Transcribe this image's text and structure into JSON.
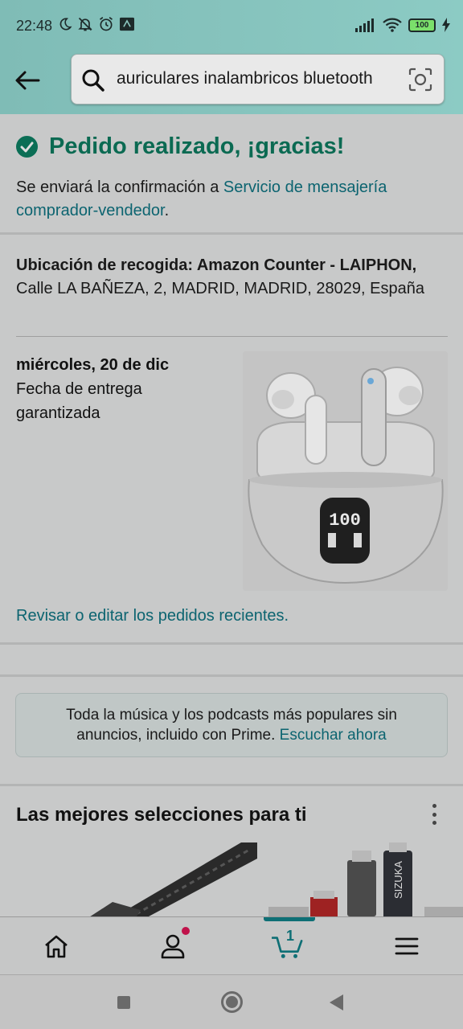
{
  "status_bar": {
    "time": "22:48",
    "battery": "100"
  },
  "header": {
    "search_query": "auriculares inalambricos bluetooth"
  },
  "confirmation": {
    "title": "Pedido realizado, ¡gracias!",
    "text_prefix": "Se enviará la confirmación a ",
    "link_text": "Servicio de mensajería comprador-vendedor",
    "text_suffix": "."
  },
  "pickup": {
    "label": "Ubicación de recogida: Amazon Counter - LAIPHON,",
    "address": "Calle LA BAÑEZA, 2, MADRID, MADRID, 28029, España",
    "delivery_date": "miércoles, 20 de dic",
    "delivery_note_line1": "Fecha de entrega",
    "delivery_note_line2": "garantizada",
    "product_display": "100",
    "review_link": "Revisar o editar los pedidos recientes."
  },
  "promo": {
    "text": "Toda la música y los podcasts más populares sin anuncios, incluido con Prime. ",
    "link": "Escuchar ahora"
  },
  "picks": {
    "title": "Las mejores selecciones para ti",
    "brand_text": "SIZUKA"
  },
  "bottom_nav": {
    "cart_count": "1",
    "items": [
      "home-icon",
      "account-icon",
      "cart-icon",
      "menu-icon"
    ]
  },
  "colors": {
    "accent": "#0b6a52",
    "link": "#0c6470",
    "header_teal": "#86c3bd",
    "notification": "#c0124a"
  }
}
